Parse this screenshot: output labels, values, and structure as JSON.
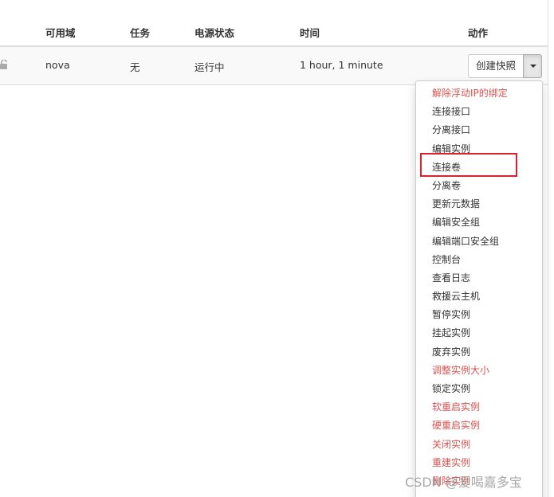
{
  "table": {
    "headers": {
      "availability_zone": "可用域",
      "task": "任务",
      "power_state": "电源状态",
      "time": "时间",
      "actions": "动作"
    },
    "row": {
      "availability_zone": "nova",
      "task": "无",
      "power_state": "运行中",
      "time": "1 hour, 1 minute"
    }
  },
  "actions": {
    "primary_label": "创建快照",
    "menu_items": [
      {
        "label": "解除浮动IP的绑定",
        "style": "danger"
      },
      {
        "label": "连接接口",
        "style": "normal"
      },
      {
        "label": "分离接口",
        "style": "normal"
      },
      {
        "label": "编辑实例",
        "style": "normal"
      },
      {
        "label": "连接卷",
        "style": "normal",
        "highlighted": true
      },
      {
        "label": "分离卷",
        "style": "normal"
      },
      {
        "label": "更新元数据",
        "style": "normal"
      },
      {
        "label": "编辑安全组",
        "style": "normal"
      },
      {
        "label": "编辑端口安全组",
        "style": "normal"
      },
      {
        "label": "控制台",
        "style": "normal"
      },
      {
        "label": "查看日志",
        "style": "normal"
      },
      {
        "label": "救援云主机",
        "style": "normal"
      },
      {
        "label": "暂停实例",
        "style": "normal"
      },
      {
        "label": "挂起实例",
        "style": "normal"
      },
      {
        "label": "废弃实例",
        "style": "normal"
      },
      {
        "label": "调整实例大小",
        "style": "danger"
      },
      {
        "label": "锁定实例",
        "style": "normal"
      },
      {
        "label": "软重启实例",
        "style": "danger"
      },
      {
        "label": "硬重启实例",
        "style": "danger"
      },
      {
        "label": "关闭实例",
        "style": "danger"
      },
      {
        "label": "重建实例",
        "style": "danger"
      },
      {
        "label": "删除实例",
        "style": "danger"
      }
    ]
  },
  "watermark": "CSDN @爱喝嘉多宝",
  "colors": {
    "danger": "#d9534f",
    "highlight_border": "#d9232e",
    "text": "#333333"
  },
  "icons": {
    "row_lock": "unlock-icon",
    "toggle": "caret-down-icon"
  }
}
